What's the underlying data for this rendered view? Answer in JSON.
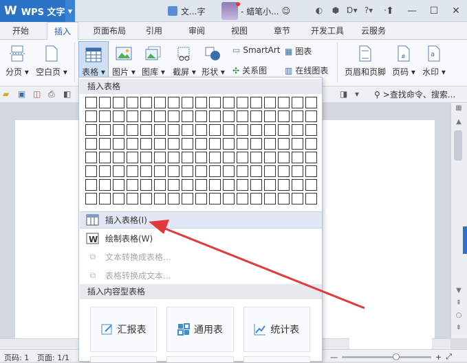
{
  "app": {
    "name": "WPS 文字",
    "doc_tab": "文...字",
    "user": "- 蜡笔小..."
  },
  "tabs": [
    "开始",
    "插入",
    "页面布局",
    "引用",
    "审阅",
    "视图",
    "章节",
    "开发工具",
    "云服务"
  ],
  "active_tab": "插入",
  "ribbon": {
    "page_break": "分页 ▾",
    "blank_page": "空白页 ▾",
    "table": "表格 ▾",
    "picture": "图片 ▾",
    "gallery": "图库 ▾",
    "screenshot": "截屏 ▾",
    "shapes": "形状 ▾",
    "smartart": "SmartArt",
    "chart": "图表",
    "relation": "关系图",
    "online_chart": "在线图表",
    "header_footer": "页眉和页脚",
    "page_number": "页码 ▾",
    "watermark": "水印 ▾"
  },
  "search": {
    "placeholder": ">查找命令、搜索..."
  },
  "dropdown": {
    "insert_table_header": "插入表格",
    "insert_table": "插入表格(I)",
    "draw_table": "绘制表格(W)",
    "text_to_table": "文本转换成表格...",
    "table_to_text": "表格转换成文本...",
    "content_table_header": "插入内容型表格",
    "cards": [
      "汇报表",
      "通用表",
      "统计表"
    ]
  },
  "status": {
    "page_num": "页码: 1",
    "page_of": "页面: 1/1"
  },
  "colors": {
    "accent": "#2b73c6",
    "arrow": "#e03a3a"
  }
}
